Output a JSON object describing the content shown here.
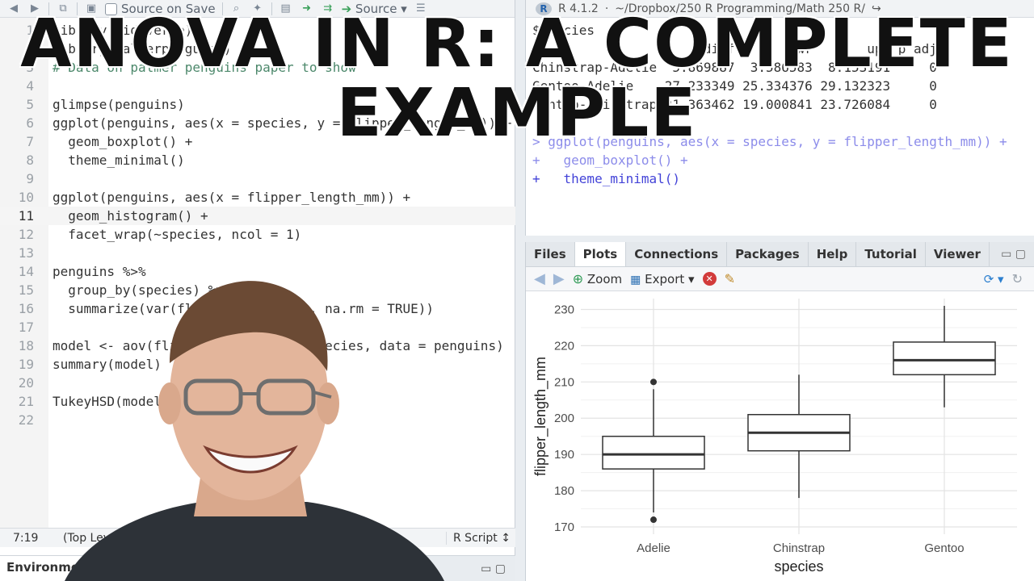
{
  "editor": {
    "toolbar": {
      "source_on_save_label": "Source on Save",
      "source_label": "Source"
    },
    "lines": [
      {
        "num": "1",
        "text": "library(tidyverse)"
      },
      {
        "num": "2",
        "text": "library(palmerpenguins)"
      },
      {
        "num": "3",
        "text": "# Data on palmer penguins paper to show"
      },
      {
        "num": "4",
        "text": ""
      },
      {
        "num": "5",
        "text": "glimpse(penguins)"
      },
      {
        "num": "6",
        "text": "ggplot(penguins, aes(x = species, y = flipper_length_mm)) +"
      },
      {
        "num": "7",
        "text": "  geom_boxplot() +"
      },
      {
        "num": "8",
        "text": "  theme_minimal()"
      },
      {
        "num": "9",
        "text": ""
      },
      {
        "num": "10",
        "text": "ggplot(penguins, aes(x = flipper_length_mm)) +"
      },
      {
        "num": "11",
        "text": "  geom_histogram() +"
      },
      {
        "num": "12",
        "text": "  facet_wrap(~species, ncol = 1)"
      },
      {
        "num": "13",
        "text": ""
      },
      {
        "num": "14",
        "text": "penguins %>%"
      },
      {
        "num": "15",
        "text": "  group_by(species) %>%"
      },
      {
        "num": "16",
        "text": "  summarize(var(flipper_length_mm, na.rm = TRUE))"
      },
      {
        "num": "17",
        "text": ""
      },
      {
        "num": "18",
        "text": "model <- aov(flipper_length_mm ~ species, data = penguins)"
      },
      {
        "num": "19",
        "text": "summary(model)"
      },
      {
        "num": "20",
        "text": ""
      },
      {
        "num": "21",
        "text": "TukeyHSD(model)"
      },
      {
        "num": "22",
        "text": ""
      }
    ],
    "status": {
      "position": "7:19",
      "scope": "(Top Level) ↕",
      "file_type": "R Script ↕"
    },
    "bottom_tab": "Environment"
  },
  "console": {
    "version": "R 4.1.2",
    "path": "~/Dropbox/250 R Programming/Math 250 R/",
    "lines": [
      {
        "text": "$species",
        "kind": "out"
      },
      {
        "text": "                      diff       lwr       upr p adj",
        "kind": "out"
      },
      {
        "text": "Chinstrap-Adelie  5.869887  3.586583  8.153191     0",
        "kind": "out"
      },
      {
        "text": "Gentoo-Adelie    27.233349 25.334376 29.132323     0",
        "kind": "out"
      },
      {
        "text": "Gentoo-Chinstrap 21.363462 19.000841 23.726084     0",
        "kind": "out"
      },
      {
        "text": "",
        "kind": "out"
      },
      {
        "text": "> ggplot(penguins, aes(x = species, y = flipper_length_mm)) +",
        "kind": "cmd-dim"
      },
      {
        "text": "+   geom_boxplot() +",
        "kind": "cmd-dim"
      },
      {
        "text": "+   theme_minimal()",
        "kind": "cmd"
      }
    ]
  },
  "plots_pane": {
    "tabs": [
      "Files",
      "Plots",
      "Connections",
      "Packages",
      "Help",
      "Tutorial",
      "Viewer"
    ],
    "active_tab": "Plots",
    "toolbar": {
      "zoom_label": "Zoom",
      "export_label": "Export"
    }
  },
  "chart_data": {
    "type": "boxplot",
    "categories": [
      "Adelie",
      "Chinstrap",
      "Gentoo"
    ],
    "xlabel": "species",
    "ylabel": "flipper_length_mm",
    "ylim": [
      168,
      233
    ],
    "yticks": [
      170,
      180,
      190,
      200,
      210,
      220,
      230
    ],
    "boxes": [
      {
        "name": "Adelie",
        "whisker_low": 174,
        "q1": 186,
        "median": 190,
        "q3": 195,
        "whisker_high": 208,
        "outliers": [
          172,
          210
        ]
      },
      {
        "name": "Chinstrap",
        "whisker_low": 178,
        "q1": 191,
        "median": 196,
        "q3": 201,
        "whisker_high": 212,
        "outliers": []
      },
      {
        "name": "Gentoo",
        "whisker_low": 203,
        "q1": 212,
        "median": 216,
        "q3": 221,
        "whisker_high": 231,
        "outliers": []
      }
    ],
    "grid": true,
    "theme": "minimal"
  },
  "title": {
    "line1": "Anova in R: A Complete",
    "line2": "Example"
  },
  "colors": {
    "keyword": "#4343d8",
    "comment": "#4c886b",
    "number": "#1f3c9e",
    "box_fill": "#ffffff",
    "box_line": "#333333"
  }
}
